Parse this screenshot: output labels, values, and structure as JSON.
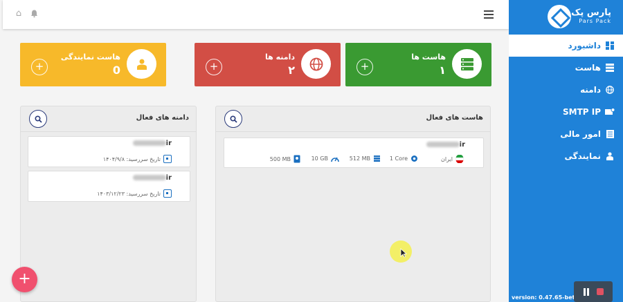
{
  "sidebar": {
    "logo_fa": "پارس پک",
    "logo_en": "Pars Pack",
    "items": [
      {
        "label": "داشبورد",
        "icon": "dashboard-icon",
        "active": true
      },
      {
        "label": "هاست",
        "icon": "server-icon",
        "active": false
      },
      {
        "label": "دامنه",
        "icon": "globe-icon",
        "active": false
      },
      {
        "label": "SMTP IP",
        "icon": "mail-icon",
        "active": false
      },
      {
        "label": "امور مالی",
        "icon": "invoice-icon",
        "active": false
      },
      {
        "label": "نمایندگی",
        "icon": "reseller-icon",
        "active": false
      }
    ],
    "version": "version: 0.47.65-beta"
  },
  "cards": {
    "hosts": {
      "title": "هاست ها",
      "count": "۱",
      "color": "#3a9a32"
    },
    "domains": {
      "title": "دامنه ها",
      "count": "۲",
      "color": "#d24e45"
    },
    "reseller": {
      "title": "هاست نمایندگی",
      "count": "0",
      "color": "#f7b92a"
    }
  },
  "active_hosts": {
    "title": "هاست های فعال",
    "items": [
      {
        "name_suffix": "ir",
        "location": "ایران",
        "cpu": "1 Core",
        "ram": "512 MB",
        "disk": "10 GB",
        "storage": "500 MB"
      }
    ]
  },
  "active_domains": {
    "title": "دامنه های فعال",
    "items": [
      {
        "name_suffix": "ir",
        "expiry": "تاریخ سررسید: ۱۴۰۴/۹/۸"
      },
      {
        "name_suffix": "ir",
        "expiry": "تاریخ سررسید: ۱۴۰۳/۱۲/۲۳"
      }
    ]
  },
  "fab": {
    "label": "+"
  },
  "card_plus": "+",
  "colors": {
    "sidebar": "#1f82d8",
    "fab": "#f0506e",
    "search_border": "#2a3a7a"
  }
}
